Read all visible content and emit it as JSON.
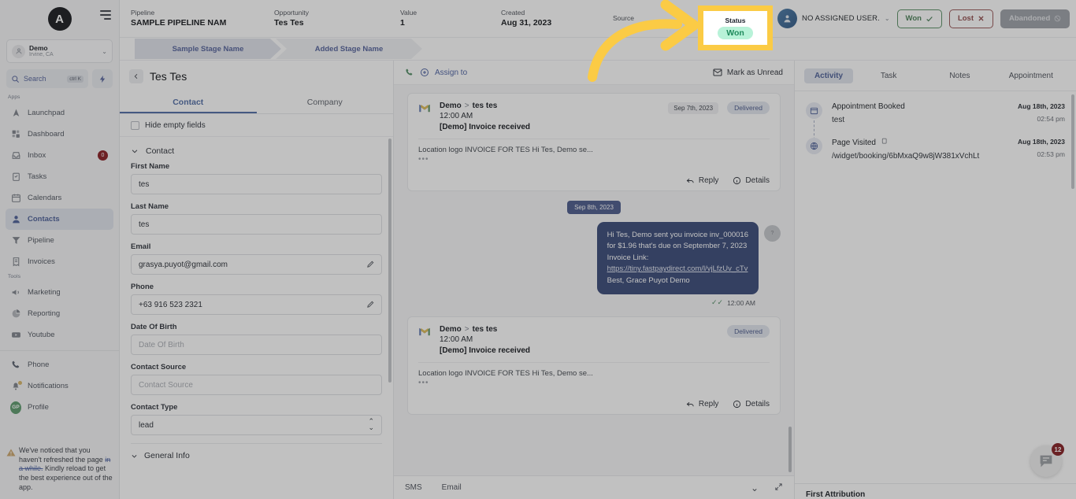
{
  "sidebar": {
    "logo": "A",
    "menu_icon": "hamburger-icon",
    "location": {
      "name": "Demo",
      "sub": "Irvine, CA"
    },
    "search": {
      "label": "Search",
      "shortcut": "ctrl K"
    },
    "apps_label": "Apps",
    "tools_label": "Tools",
    "apps": [
      {
        "label": "Launchpad",
        "icon": "launchpad-icon",
        "badge": ""
      },
      {
        "label": "Dashboard",
        "icon": "dashboard-icon",
        "badge": ""
      },
      {
        "label": "Inbox",
        "icon": "inbox-icon",
        "badge": "0"
      },
      {
        "label": "Tasks",
        "icon": "tasks-icon",
        "badge": ""
      },
      {
        "label": "Calendars",
        "icon": "calendar-icon",
        "badge": ""
      },
      {
        "label": "Contacts",
        "icon": "contacts-icon",
        "badge": ""
      },
      {
        "label": "Pipeline",
        "icon": "pipeline-icon",
        "badge": ""
      },
      {
        "label": "Invoices",
        "icon": "invoices-icon",
        "badge": ""
      }
    ],
    "tools": [
      {
        "label": "Marketing",
        "icon": "megaphone-icon"
      },
      {
        "label": "Reporting",
        "icon": "pie-chart-icon"
      },
      {
        "label": "Youtube",
        "icon": "youtube-icon"
      }
    ],
    "bottom": [
      {
        "label": "Phone",
        "icon": "phone-icon"
      },
      {
        "label": "Notifications",
        "icon": "bell-icon"
      },
      {
        "label": "Profile",
        "icon": "avatar-icon",
        "initials": "GP"
      }
    ],
    "warning": {
      "part1": "We've noticed that you haven't refreshed the page ",
      "link": "in a while.",
      "part2": " Kindly reload to get the best experience out of the app."
    }
  },
  "header": {
    "pipeline_label": "Pipeline",
    "pipeline_value": "SAMPLE PIPELINE NAM",
    "opportunity_label": "Opportunity",
    "opportunity_value": "Tes Tes",
    "value_label": "Value",
    "value_value": "1",
    "created_label": "Created",
    "created_value": "Aug 31, 2023",
    "source_label": "Source",
    "status_label": "Status",
    "status_value": "Won",
    "assignee": "NO ASSIGNED USER.",
    "won_button": "Won",
    "lost_button": "Lost",
    "abandoned_button": "Abandoned",
    "highlight_color": "#fbcb45"
  },
  "stages": [
    {
      "label": "Sample Stage Name",
      "active": true
    },
    {
      "label": "Added Stage Name",
      "active": false
    }
  ],
  "contact_panel": {
    "title": "Tes Tes",
    "tabs": [
      {
        "label": "Contact",
        "active": true
      },
      {
        "label": "Company",
        "active": false
      }
    ],
    "hide_empty": "Hide empty fields",
    "group": "Contact",
    "fields": [
      {
        "label": "First Name",
        "value": "tes",
        "placeholder": "First Name",
        "edit": false,
        "type": "text"
      },
      {
        "label": "Last Name",
        "value": "tes",
        "placeholder": "Last Name",
        "edit": false,
        "type": "text"
      },
      {
        "label": "Email",
        "value": "grasya.puyot@gmail.com",
        "placeholder": "Email",
        "edit": true,
        "type": "text"
      },
      {
        "label": "Phone",
        "value": "+63 916 523 2321",
        "placeholder": "Phone",
        "edit": true,
        "type": "text"
      },
      {
        "label": "Date Of Birth",
        "value": "",
        "placeholder": "Date Of Birth",
        "edit": false,
        "type": "text"
      },
      {
        "label": "Contact Source",
        "value": "",
        "placeholder": "Contact Source",
        "edit": false,
        "type": "text"
      },
      {
        "label": "Contact Type",
        "value": "lead",
        "placeholder": "Contact Type",
        "edit": false,
        "type": "select"
      }
    ],
    "next_group": "General Info"
  },
  "conversation": {
    "assign_to": "Assign to",
    "mark_unread": "Mark as Unread",
    "messages": [
      {
        "kind": "email",
        "from": "Demo",
        "to": "tes tes",
        "time": "12:00 AM",
        "subject": "[Demo] Invoice received",
        "preview": "Location logo INVOICE FOR TES Hi Tes,  Demo se...",
        "date_pill": "Sep 7th, 2023",
        "status": "Delivered",
        "reply": "Reply",
        "details": "Details"
      },
      {
        "kind": "sms",
        "date_pill": "Sep 8th, 2023",
        "line1": "Hi Tes, Demo sent you invoice inv_000016",
        "line2": "for $1.96 that's due on September 7, 2023",
        "line3": "Invoice Link:",
        "link": "https://tiny.fastpaydirect.com/l/vjLfzUv_cTv",
        "line4": "Best, Grace Puyot Demo",
        "time": "12:00 AM"
      },
      {
        "kind": "email",
        "from": "Demo",
        "to": "tes tes",
        "time": "12:00 AM",
        "subject": "[Demo] Invoice received",
        "preview": "Location logo INVOICE FOR TES Hi Tes,  Demo se...",
        "date_pill": "",
        "status": "Delivered",
        "reply": "Reply",
        "details": "Details"
      }
    ],
    "footer_tabs": [
      "SMS",
      "Email"
    ]
  },
  "activity_panel": {
    "tabs": [
      {
        "label": "Activity",
        "active": true
      },
      {
        "label": "Task",
        "active": false
      },
      {
        "label": "Notes",
        "active": false
      },
      {
        "label": "Appointment",
        "active": false
      }
    ],
    "items": [
      {
        "icon": "calendar-icon",
        "title": "Appointment Booked",
        "sub": "test",
        "date": "Aug 18th, 2023",
        "time": "02:54 pm",
        "copy": false
      },
      {
        "icon": "globe-icon",
        "title": "Page Visited",
        "sub": "/widget/booking/6bMxaQ9w8jW381xVchLt",
        "date": "Aug 18th, 2023",
        "time": "02:53 pm",
        "copy": true
      }
    ],
    "first_attribution": "First Attribution",
    "chat_badge": "12"
  }
}
